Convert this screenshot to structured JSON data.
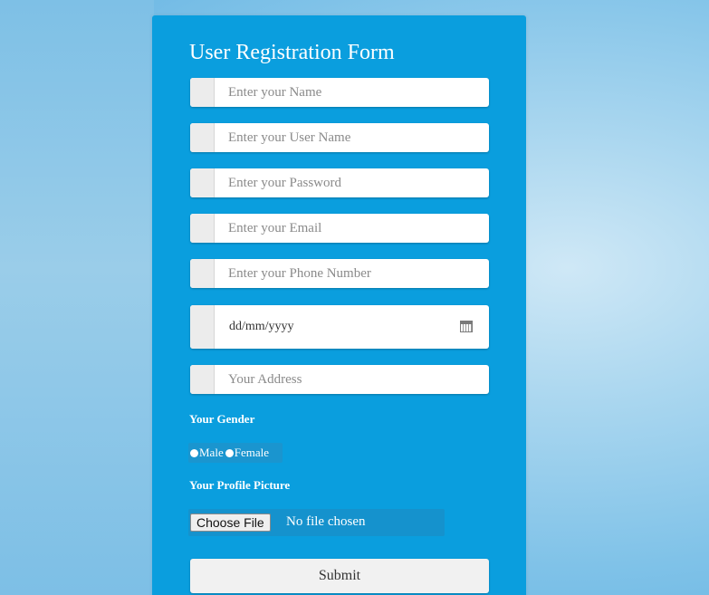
{
  "form": {
    "title": "User Registration Form",
    "fields": {
      "name": {
        "placeholder": "Enter your Name"
      },
      "username": {
        "placeholder": "Enter your User Name"
      },
      "password": {
        "placeholder": "Enter your Password"
      },
      "email": {
        "placeholder": "Enter your Email"
      },
      "phone": {
        "placeholder": "Enter your Phone Number"
      },
      "date": {
        "placeholder": "dd/mm/yyyy",
        "icon": "calendar-icon"
      },
      "address": {
        "placeholder": "Your Address"
      }
    },
    "gender": {
      "label": "Your Gender",
      "options": [
        "Male",
        "Female"
      ]
    },
    "profile_picture": {
      "label": "Your Profile Picture",
      "button_label": "Choose File",
      "status": "No file chosen"
    },
    "submit_label": "Submit"
  },
  "colors": {
    "panel": "#0a9ede",
    "text_light": "#ffffff",
    "field_bg": "#ffffff",
    "addon_bg": "#ececec"
  }
}
